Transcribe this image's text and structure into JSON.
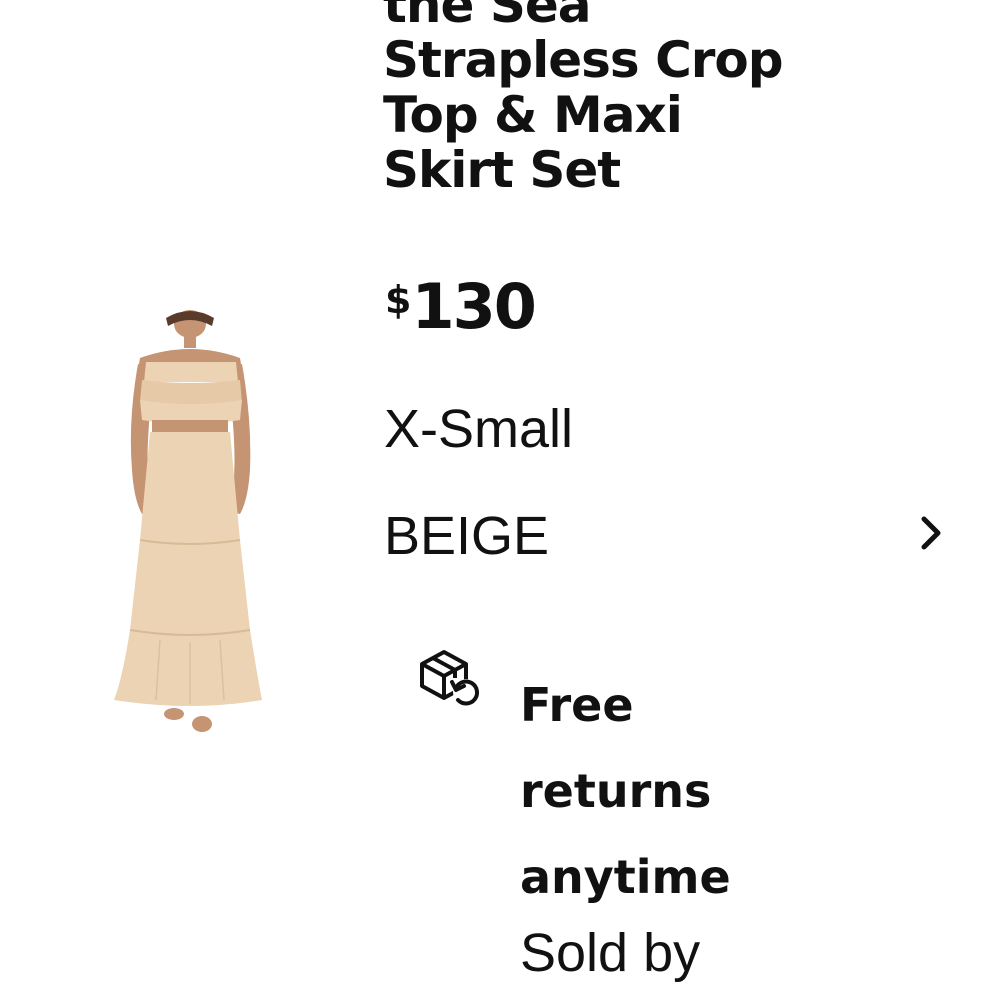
{
  "product": {
    "title_lines": [
      "the Sea",
      "Strapless Crop",
      "Top & Maxi",
      "Skirt Set"
    ],
    "image_icon": "product-photo",
    "price": {
      "currency": "$",
      "amount": "130"
    },
    "size": "X-Small",
    "color": "BEIGE",
    "color_chevron_icon": "chevron-right-icon"
  },
  "returns": {
    "icon": "box-return-icon",
    "lines": [
      "Free",
      "returns",
      "anytime"
    ]
  },
  "seller": {
    "sold_by_label": "Sold by"
  },
  "colors": {
    "text": "#111111",
    "background": "#ffffff",
    "garment": "#ecd3b4"
  }
}
